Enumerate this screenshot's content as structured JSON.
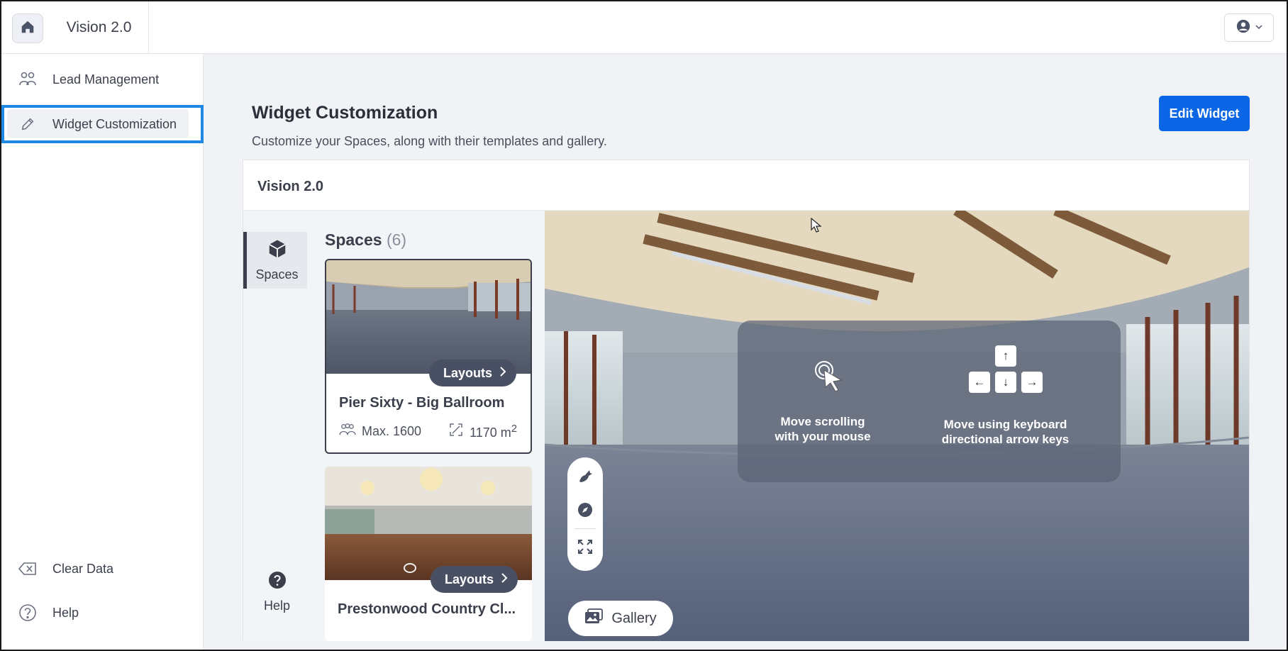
{
  "app": {
    "title": "Vision 2.0"
  },
  "topbar": {
    "home_icon": "home-icon",
    "user_icon": "user-circle-icon"
  },
  "sidebar": {
    "items": [
      {
        "label": "Lead Management",
        "icon": "people-icon"
      },
      {
        "label": "Widget Customization",
        "icon": "pencil-icon",
        "active": true
      }
    ],
    "bottom_items": [
      {
        "label": "Clear Data",
        "icon": "clear-icon"
      },
      {
        "label": "Help",
        "icon": "help-circle-icon"
      }
    ]
  },
  "main": {
    "title": "Widget Customization",
    "subtitle": "Customize your Spaces, along with their templates and gallery.",
    "edit_button": "Edit Widget"
  },
  "widget": {
    "title": "Vision 2.0",
    "rail": {
      "spaces_label": "Spaces",
      "help_label": "Help"
    },
    "spaces_heading": "Spaces",
    "spaces_count": "(6)",
    "spaces": [
      {
        "name": "Pier Sixty - Big Ballroom",
        "layouts_label": "Layouts",
        "capacity": "Max. 1600",
        "area": "1170",
        "area_unit": "m",
        "area_sup": "2",
        "selected": true
      },
      {
        "name": "Prestonwood Country Cl...",
        "layouts_label": "Layouts",
        "selected": false
      }
    ],
    "viewer": {
      "mouse_hint": "Move scrolling with your mouse",
      "mouse_hint_line1": "Move scrolling",
      "mouse_hint_line2": "with your mouse",
      "keys_hint_line1": "Move using keyboard",
      "keys_hint_line2": "directional arrow keys",
      "arrow_up": "↑",
      "arrow_left": "←",
      "arrow_down": "↓",
      "arrow_right": "→",
      "gallery_label": "Gallery"
    }
  },
  "colors": {
    "accent": "#0a66e4",
    "selection": "#1e88e5",
    "dark": "#3a3f4b"
  }
}
